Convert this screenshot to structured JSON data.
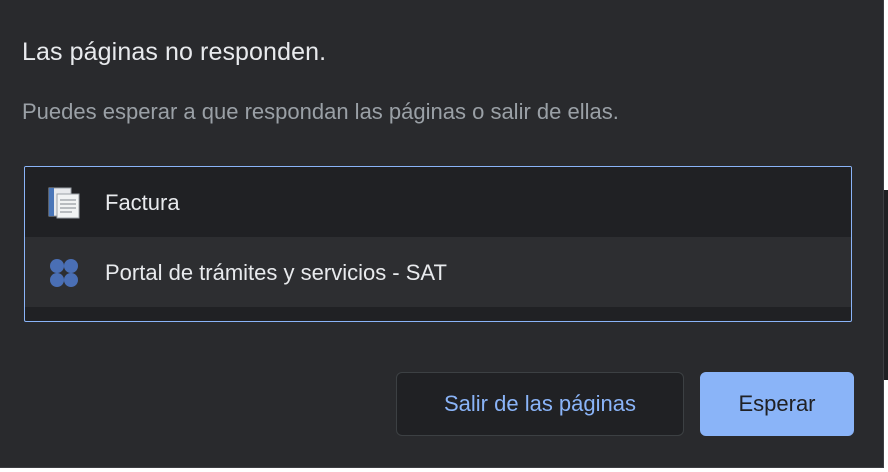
{
  "dialog": {
    "title": "Las páginas no responden.",
    "message": "Puedes esperar a que respondan las páginas o salir de ellas."
  },
  "pages": [
    {
      "label": "Factura",
      "icon": "document-icon"
    },
    {
      "label": "Portal de trámites y servicios - SAT",
      "icon": "grid-dots-icon"
    }
  ],
  "buttons": {
    "exit_label": "Salir de las páginas",
    "wait_label": "Esperar"
  },
  "colors": {
    "background": "#292a2d",
    "accent": "#8ab4f8",
    "text_primary": "#e8eaed",
    "text_secondary": "#9aa0a6"
  }
}
